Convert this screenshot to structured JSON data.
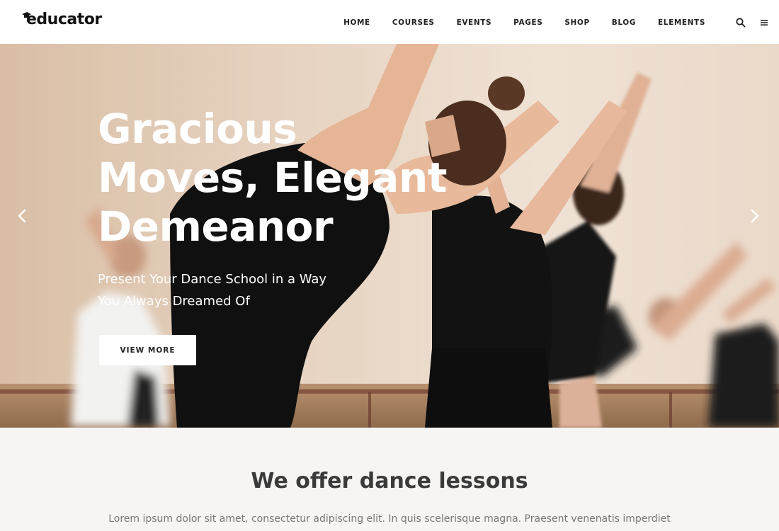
{
  "header": {
    "logo": "educator",
    "nav": [
      "HOME",
      "COURSES",
      "EVENTS",
      "PAGES",
      "SHOP",
      "BLOG",
      "ELEMENTS"
    ],
    "icons": {
      "search": "search-icon",
      "menu": "hamburger-menu-icon"
    }
  },
  "hero": {
    "title_lines": [
      "Gracious",
      "Moves, Elegant",
      "Demeanor"
    ],
    "subtitle_lines": [
      "Present Your Dance School in a Way",
      "You Always Dreamed Of"
    ],
    "button": "VIEW MORE",
    "prev_icon": "chevron-left-icon",
    "next_icon": "chevron-right-icon"
  },
  "intro": {
    "title": "We offer dance lessons",
    "text": "Lorem ipsum dolor sit amet, consectetur adipiscing elit. In quis scelerisque magna. Praesent venenatis imperdiet"
  },
  "colors": {
    "header_bg": "#ffffff",
    "section_bg": "#f6f5f3",
    "text_dark": "#222222",
    "hero_text": "#ffffff"
  }
}
